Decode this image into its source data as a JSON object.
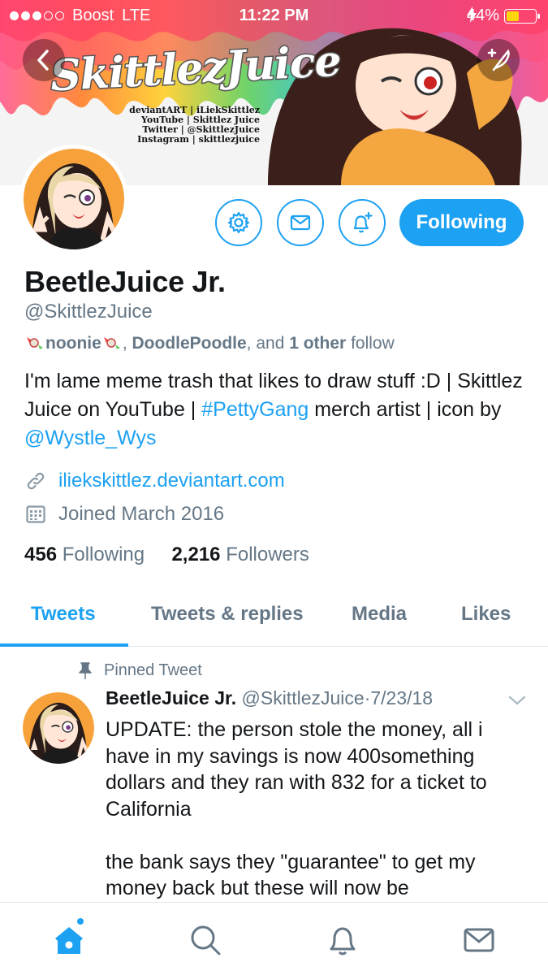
{
  "status_bar": {
    "carrier": "Boost",
    "network": "LTE",
    "time": "11:22 PM",
    "battery": "44%",
    "battery_level": 0.44
  },
  "banner": {
    "title": "SkittlezJuice",
    "lines": [
      "deviantART | iLiekSkittlez",
      "YouTube | Skittlez Juice",
      "Twitter | @SkittlezJuice",
      "Instagram | skittlezjuice"
    ]
  },
  "profile": {
    "name": "BeetleJuice Jr.",
    "handle": "@SkittlezJuice",
    "followed_by": {
      "name1": "noonie",
      "sep1": ", ",
      "name2": "DoodlePoodle",
      "and": ", and ",
      "other": "1 other",
      "suffix": " follow"
    },
    "bio": {
      "part1": "I'm lame meme trash that likes to draw stuff :D | Skittlez Juice on YouTube | ",
      "hashtag": "#PettyGang",
      "part2": " merch artist | icon by ",
      "mention": "@Wystle_Wys"
    },
    "website": "iliekskittlez.deviantart.com",
    "joined": "Joined March 2016",
    "following_count": "456",
    "following_label": "Following",
    "followers_count": "2,216",
    "followers_label": "Followers"
  },
  "actions": {
    "follow_label": "Following",
    "settings_icon": "gear-icon",
    "message_icon": "envelope-icon",
    "notify_icon": "bell-plus-icon"
  },
  "tabs": [
    {
      "label": "Tweets",
      "active": true
    },
    {
      "label": "Tweets & replies",
      "active": false
    },
    {
      "label": "Media",
      "active": false
    },
    {
      "label": "Likes",
      "active": false
    }
  ],
  "tweet": {
    "pinned_label": "Pinned Tweet",
    "author": "BeetleJuice Jr.",
    "handle": "@SkittlezJuice",
    "dot": "·",
    "date": "7/23/18",
    "text": "UPDATE: the person stole the money, all i have in my savings is now 400something dollars and they ran with 832 for a ticket to California\n\nthe bank says they \"guarantee\" to get my money back but these will now be"
  },
  "bottom_nav": [
    "home-icon",
    "search-icon",
    "notifications-icon",
    "messages-icon"
  ],
  "colors": {
    "accent": "#1da1f2",
    "text": "#14171a",
    "secondary": "#657786"
  }
}
